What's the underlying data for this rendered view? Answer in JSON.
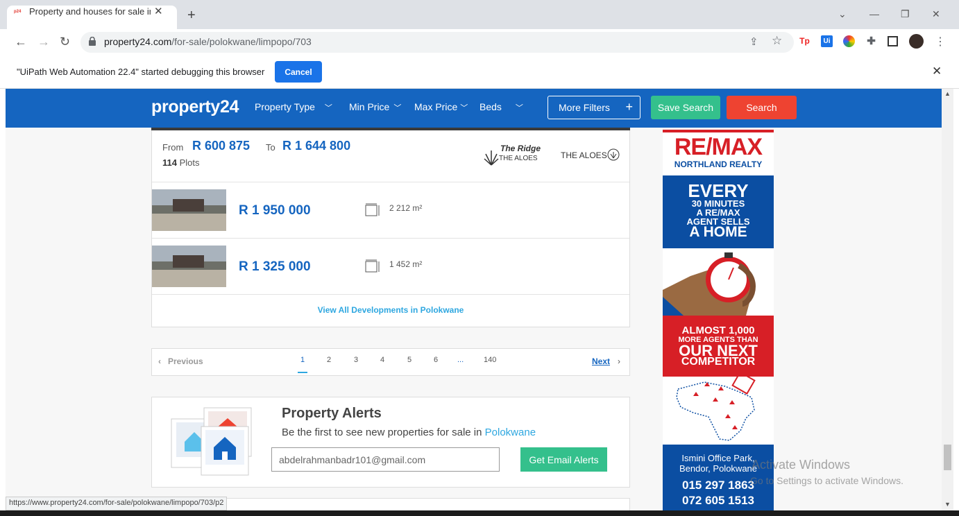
{
  "browser": {
    "tab_title": "Property and houses for sale in P",
    "favicon_text": "p24",
    "url_domain": "property24.com",
    "url_path": "/for-sale/polokwane/limpopo/703",
    "infobar_text": "\"UiPath Web Automation 22.4\" started debugging this browser",
    "infobar_cancel": "Cancel",
    "status_url": "https://www.property24.com/for-sale/polokwane/limpopo/703/p2",
    "extensions": [
      "Tp",
      "Ui"
    ]
  },
  "header": {
    "logo": "property24",
    "nav": [
      "Property Type",
      "Min Price",
      "Max Price",
      "Beds"
    ],
    "more_filters": "More Filters",
    "save_search": "Save Search",
    "search": "Search"
  },
  "development": {
    "from_label": "From",
    "from_price": "R 600 875",
    "to_label": "To",
    "to_price": "R 1 644 800",
    "plots_count": "114",
    "plots_label": "Plots",
    "logo1_line1": "The Ridge",
    "logo1_line2": "THE ALOES",
    "logo2": "THE ALOES",
    "units": [
      {
        "price": "R 1 950 000",
        "area": "2 212 m²"
      },
      {
        "price": "R 1 325 000",
        "area": "1 452 m²"
      }
    ],
    "view_all": "View All Developments in Polokwane"
  },
  "pagination": {
    "previous": "Previous",
    "pages": [
      "1",
      "2",
      "3",
      "4",
      "5",
      "6",
      "...",
      "140"
    ],
    "current": "1",
    "next": "Next"
  },
  "alerts": {
    "title": "Property Alerts",
    "subtitle": "Be the first to see new properties for sale in",
    "location": "Polokwane",
    "email_value": "abdelrahmanbadr101@gmail.com",
    "button": "Get Email Alerts"
  },
  "ad": {
    "brand": "RE/MAX",
    "brand_sub": "NORTHLAND REALTY",
    "line1": "EVERY",
    "line2": "30 MINUTES",
    "line3": "A RE/MAX",
    "line4": "AGENT SELLS",
    "line5": "A HOME",
    "almost": "ALMOST 1,000",
    "more_agents": "MORE AGENTS THAN",
    "our_next": "OUR NEXT",
    "competitor": "COMPETITOR",
    "office1": "Ismini Office Park,",
    "office2": "Bendor, Polokwane",
    "phone1": "015 297 1863",
    "phone2": "072 605 1513"
  },
  "watermark": {
    "line1": "Activate Windows",
    "line2": "Go to Settings to activate Windows."
  },
  "colors": {
    "brand_blue": "#1565c0",
    "save_green": "#34c08c",
    "search_red": "#ee4331",
    "remax_red": "#d71f26",
    "remax_blue": "#0b4ea2"
  }
}
